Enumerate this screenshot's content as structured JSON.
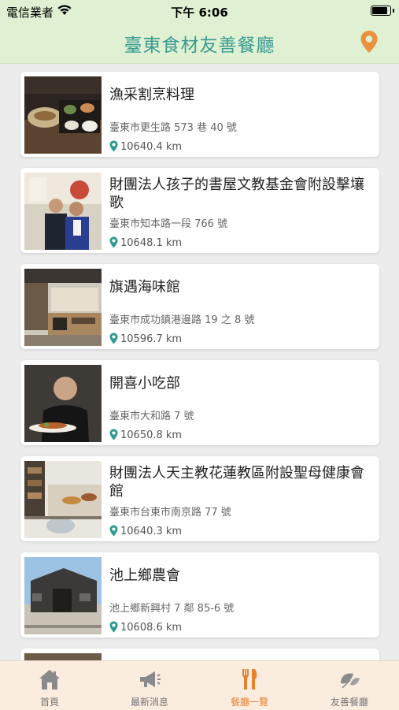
{
  "status_bar": {
    "carrier": "電信業者",
    "time": "下午 6:06",
    "battery_level": 0.95
  },
  "header": {
    "title": "臺東食材友善餐廳",
    "location_icon": "location-pin-icon"
  },
  "accent_colors": {
    "title": "#3a9a92",
    "active_tab": "#e8812e",
    "header_bg": "#dff1d2",
    "tabbar_bg": "#fbece0"
  },
  "restaurants": [
    {
      "name": "漁采割烹料理",
      "address": "臺東市更生路 573 巷 40 號",
      "distance": "10640.4 km"
    },
    {
      "name": "財團法人孩子的書屋文教基金會附設擊壤歌",
      "address": "臺東市知本路一段 766 號",
      "distance": "10648.1 km"
    },
    {
      "name": "旗遇海味館",
      "address": "臺東市成功鎮港邊路 19 之 8 號",
      "distance": "10596.7 km"
    },
    {
      "name": "開喜小吃部",
      "address": "臺東市大和路 7 號",
      "distance": "10650.8 km"
    },
    {
      "name": "財團法人天主教花蓮教區附設聖母健康會館",
      "address": "臺東市台東市南京路 77 號",
      "distance": "10640.3 km"
    },
    {
      "name": "池上鄉農會",
      "address": "池上鄉新興村 7 鄰 85-6 號",
      "distance": "10608.6 km"
    }
  ],
  "tabs": [
    {
      "label": "首頁",
      "icon": "home-icon"
    },
    {
      "label": "最新消息",
      "icon": "megaphone-icon"
    },
    {
      "label": "餐廳一覽",
      "icon": "fork-knife-icon",
      "active": true
    },
    {
      "label": "友善餐廳",
      "icon": "leaf-icon"
    }
  ]
}
